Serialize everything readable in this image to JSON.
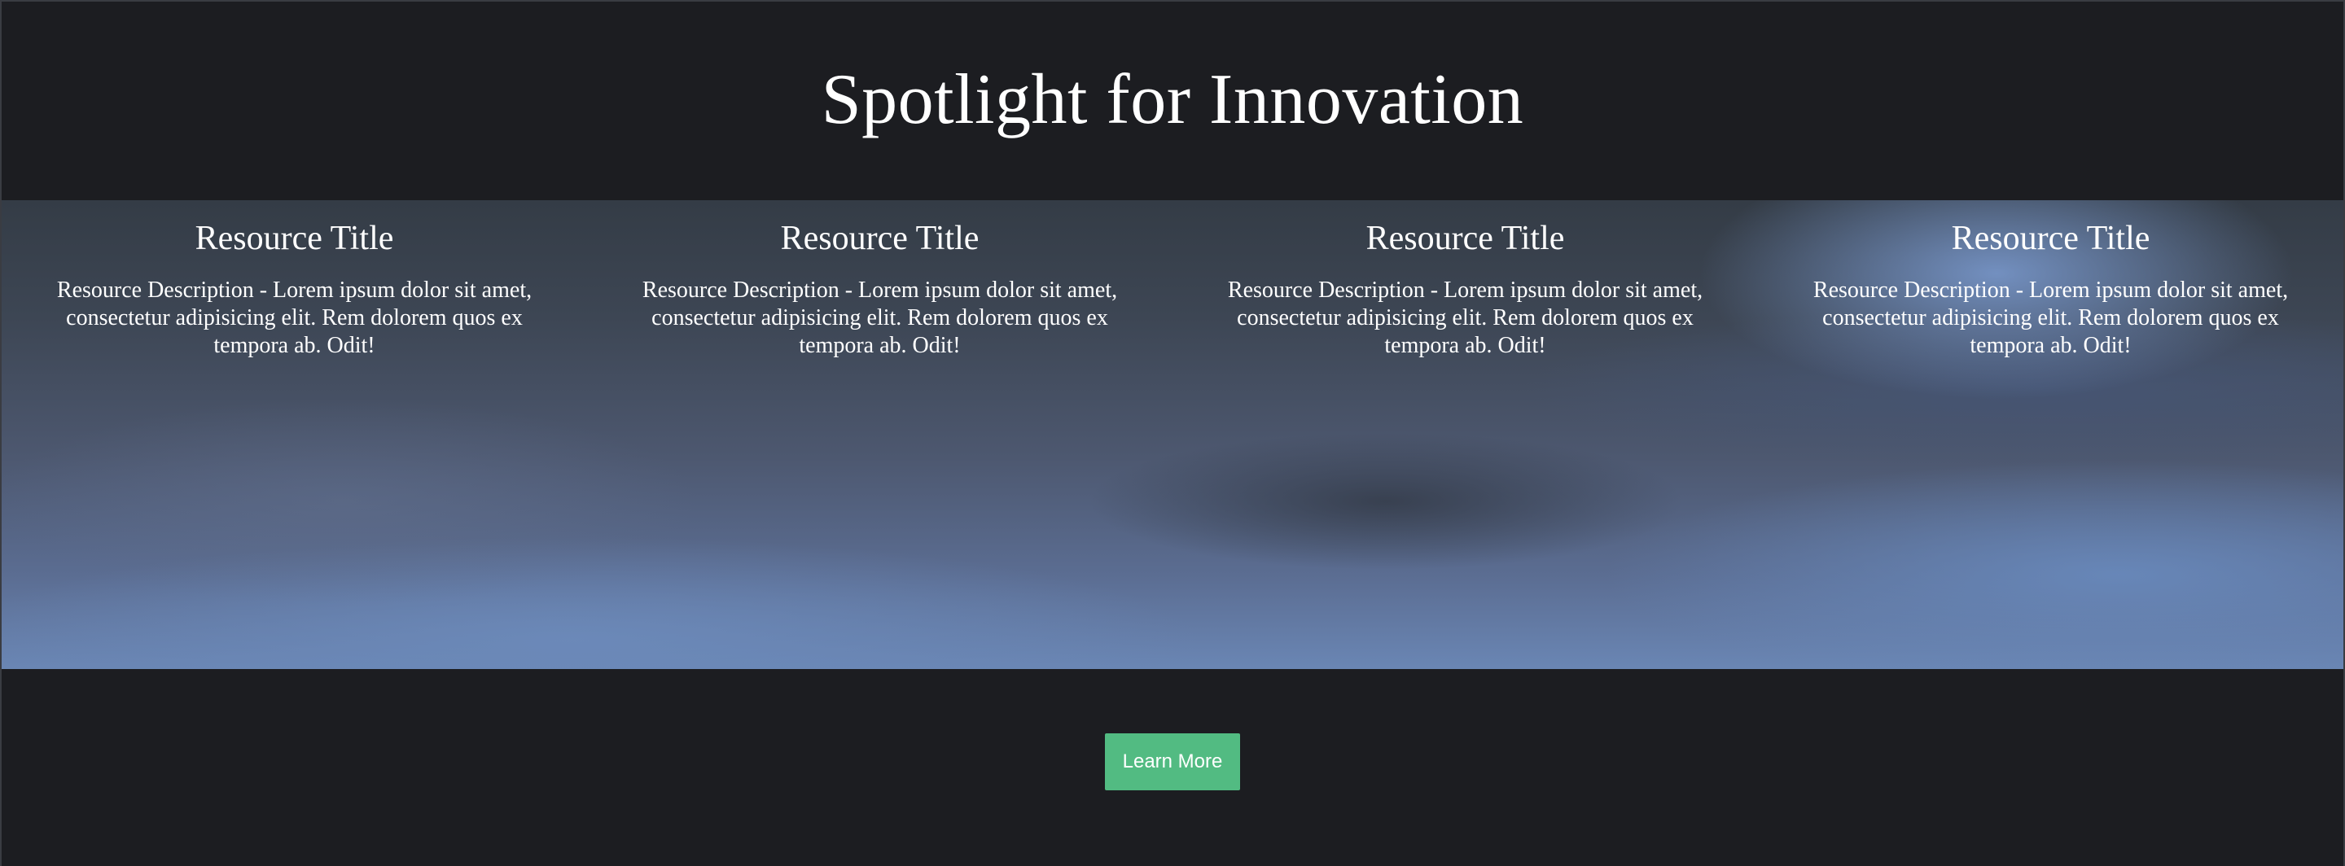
{
  "header": {
    "title": "Spotlight for Innovation"
  },
  "resources": [
    {
      "title": "Resource Title",
      "description": "Resource Description - Lorem ipsum dolor sit amet, consectetur adipisicing elit. Rem dolorem quos ex tempora ab. Odit!"
    },
    {
      "title": "Resource Title",
      "description": "Resource Description - Lorem ipsum dolor sit amet, consectetur adipisicing elit. Rem dolorem quos ex tempora ab. Odit!"
    },
    {
      "title": "Resource Title",
      "description": "Resource Description - Lorem ipsum dolor sit amet, consectetur adipisicing elit. Rem dolorem quos ex tempora ab. Odit!"
    },
    {
      "title": "Resource Title",
      "description": "Resource Description - Lorem ipsum dolor sit amet, consectetur adipisicing elit. Rem dolorem quos ex tempora ab. Odit!"
    }
  ],
  "footer": {
    "button_label": "Learn More"
  },
  "colors": {
    "page_background": "#1c1d21",
    "button_background": "#52bb82",
    "text": "#ffffff"
  }
}
